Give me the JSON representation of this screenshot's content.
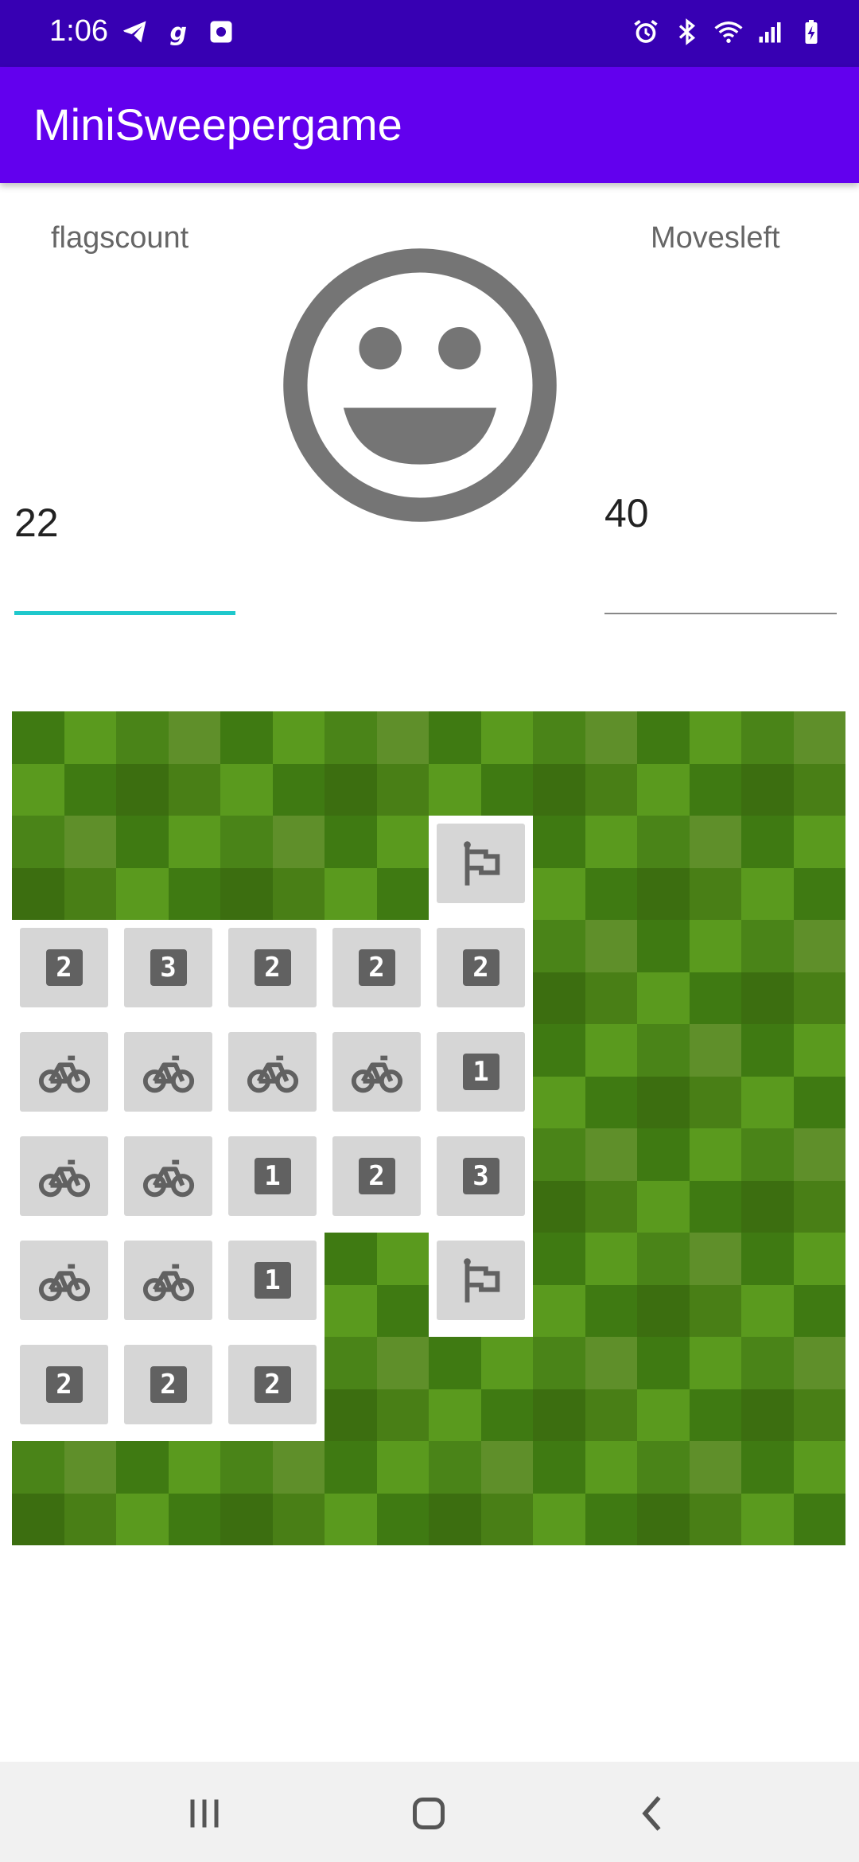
{
  "status_bar": {
    "time": "1:06",
    "left_icons": [
      "telegram-icon",
      "g-icon",
      "screen-record-icon"
    ],
    "right_icons": [
      "alarm-icon",
      "bluetooth-icon",
      "wifi-icon",
      "signal-icon",
      "battery-charging-icon"
    ]
  },
  "app_bar": {
    "title": "MiniSweepergame"
  },
  "stats": {
    "flags_label": "flagscount",
    "flags_value": "22",
    "moves_label": "Movesleft",
    "moves_value": "40"
  },
  "status_face": "smiley-icon",
  "board": {
    "rows": 8,
    "cols": 8,
    "cells": [
      [
        "hidden",
        "hidden",
        "hidden",
        "hidden",
        "hidden",
        "hidden",
        "hidden",
        "hidden"
      ],
      [
        "hidden",
        "hidden",
        "hidden",
        "hidden",
        "flag",
        "hidden",
        "hidden",
        "hidden"
      ],
      [
        "2",
        "3",
        "2",
        "2",
        "2",
        "hidden",
        "hidden",
        "hidden"
      ],
      [
        "bike",
        "bike",
        "bike",
        "bike",
        "1",
        "hidden",
        "hidden",
        "hidden"
      ],
      [
        "bike",
        "bike",
        "1",
        "2",
        "3",
        "hidden",
        "hidden",
        "hidden"
      ],
      [
        "bike",
        "bike",
        "1",
        "hidden",
        "flag",
        "hidden",
        "hidden",
        "hidden"
      ],
      [
        "2",
        "2",
        "2",
        "hidden",
        "hidden",
        "hidden",
        "hidden",
        "hidden"
      ],
      [
        "hidden",
        "hidden",
        "hidden",
        "hidden",
        "hidden",
        "hidden",
        "hidden",
        "hidden"
      ]
    ]
  },
  "nav_bar": [
    "recents-icon",
    "home-icon",
    "back-icon"
  ],
  "colors": {
    "status_bar": "#3700B3",
    "app_bar": "#6200EE",
    "flags_underline": "#1FC8CC",
    "tile": "#D6D6D6",
    "icon": "#616161"
  }
}
